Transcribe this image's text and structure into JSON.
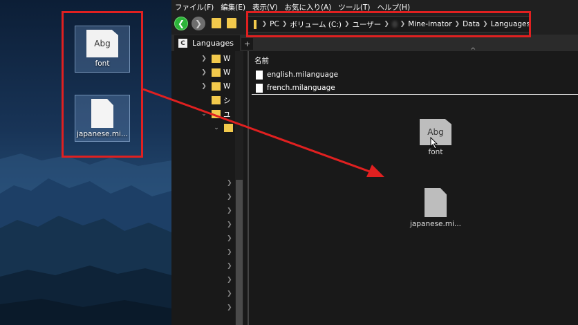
{
  "desktop": {
    "icons": [
      {
        "label": "font",
        "glyph": "Abg",
        "icon": "font-file-icon"
      },
      {
        "label": "japanese.mi...",
        "icon": "blank-file-icon"
      }
    ]
  },
  "menubar": {
    "items": [
      "ファイル(F)",
      "編集(E)",
      "表示(V)",
      "お気に入り(A)",
      "ツール(T)",
      "ヘルプ(H)"
    ]
  },
  "toolbar": {
    "back_icon": "back-arrow-icon",
    "forward_icon": "forward-arrow-icon"
  },
  "address_bar": {
    "crumbs": [
      "PC",
      "ボリューム (C:)",
      "ユーザー",
      "Mine-imator",
      "Data",
      "Languages"
    ],
    "redacted_segment": true
  },
  "tabs": [
    {
      "label": "Languages",
      "icon_text": "C"
    }
  ],
  "tab_add_label": "+",
  "tree": {
    "rows": [
      "W",
      "W",
      "W",
      "シ",
      "ユ"
    ]
  },
  "content": {
    "column_header": "名前",
    "sort_arrow": "^",
    "files": [
      "english.milanguage",
      "french.milanguage"
    ],
    "drag_icons": [
      {
        "label": "font",
        "glyph": "Abg"
      },
      {
        "label": "japanese.mi..."
      }
    ]
  },
  "annotation_color": "#e02020"
}
